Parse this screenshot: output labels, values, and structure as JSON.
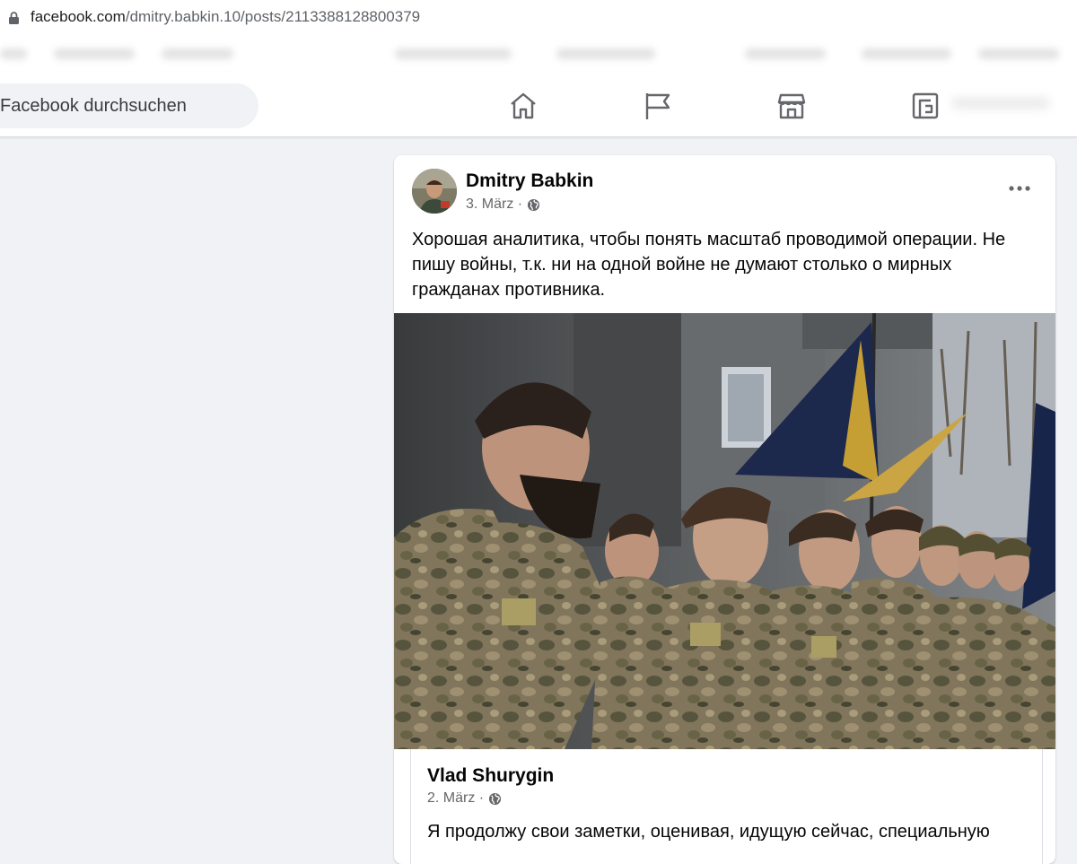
{
  "browser": {
    "url_host": "facebook.com",
    "url_path": "/dmitry.babkin.10/posts/2113388128800379"
  },
  "nav": {
    "search_placeholder": "Facebook durchsuchen",
    "icons": [
      "home-icon",
      "pages-flag-icon",
      "marketplace-icon",
      "gaming-icon"
    ]
  },
  "post": {
    "author": "Dmitry Babkin",
    "date": "3. März ·",
    "text": "Хорошая аналитика, чтобы понять масштаб проводимой операции. Не пишу войны, т.к. ни на одной войне не думают столько о мирных гражданах противника.",
    "shared": {
      "author": "Vlad Shurygin",
      "date": "2. März ·",
      "text": "Я продолжу свои заметки, оценивая, идущую сейчас, специальную"
    }
  },
  "colors": {
    "page_bg": "#f0f2f5",
    "card_bg": "#ffffff",
    "text_primary": "#050505",
    "text_secondary": "#65676b",
    "icon_gray": "#65676b"
  }
}
